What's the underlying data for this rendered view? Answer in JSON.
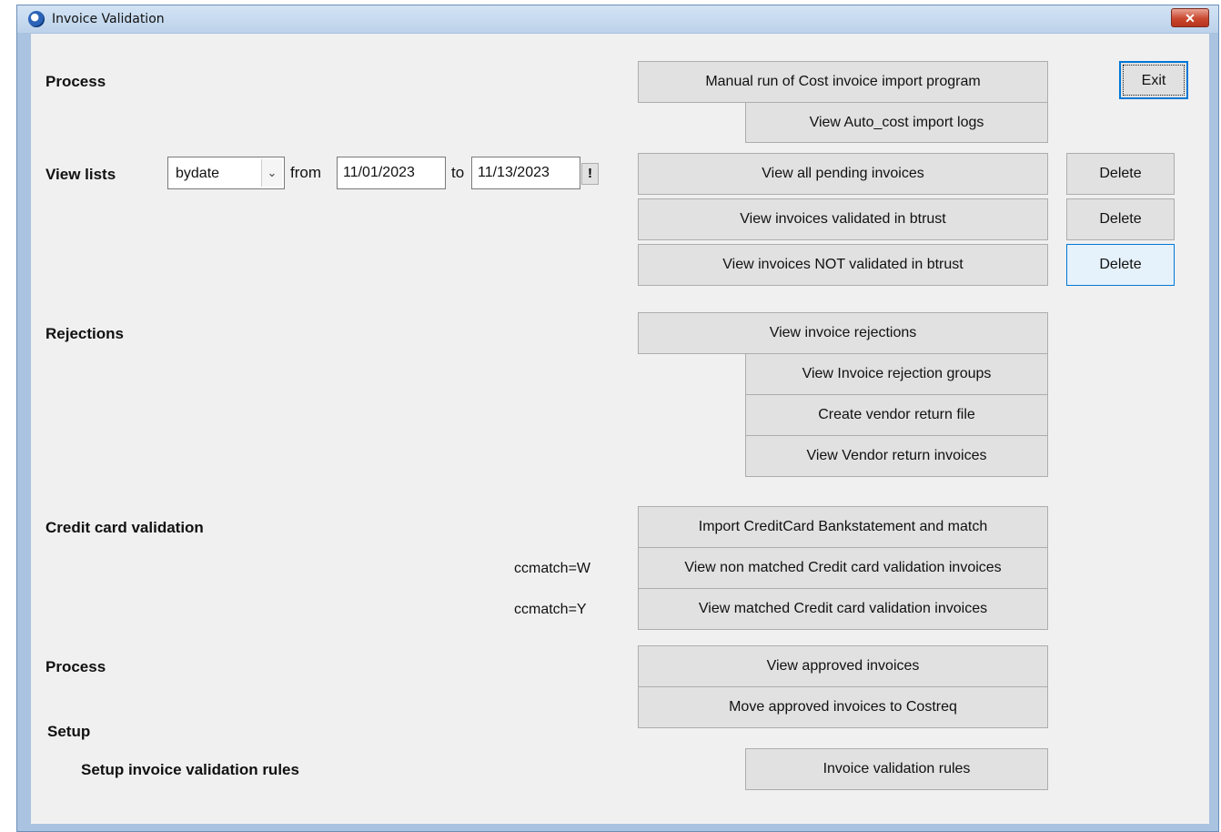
{
  "window": {
    "title": "Invoice Validation",
    "close_symbol": "✕"
  },
  "process": {
    "label": "Process",
    "manual_run_label": "Manual run of Cost invoice import program",
    "view_logs_label": "View Auto_cost import logs",
    "exit_label": "Exit"
  },
  "view_lists": {
    "label": "View lists",
    "mode_value": "bydate",
    "from_label": "from",
    "from_date": "11/01/2023",
    "to_label": "to",
    "to_date": "11/13/2023",
    "apply_label": "!",
    "pending_label": "View all pending invoices",
    "validated_label": "View invoices validated in btrust",
    "not_validated_label": "View invoices NOT validated in btrust",
    "delete_label": "Delete"
  },
  "rejections": {
    "label": "Rejections",
    "view_rejections_label": "View invoice rejections",
    "view_groups_label": "View Invoice rejection groups",
    "create_return_label": "Create vendor return file",
    "view_return_label": "View Vendor return invoices"
  },
  "credit_card": {
    "label": "Credit card validation",
    "import_label": "Import CreditCard Bankstatement and match",
    "ccmatch_w": "ccmatch=W",
    "non_matched_label": "View non matched Credit card validation invoices",
    "ccmatch_y": "ccmatch=Y",
    "matched_label": "View matched Credit card validation invoices"
  },
  "process2": {
    "label": "Process",
    "view_approved_label": "View approved invoices",
    "move_approved_label": "Move approved invoices to Costreq"
  },
  "setup": {
    "label": "Setup",
    "rules_heading": "Setup invoice validation rules",
    "rules_button_label": "Invoice validation rules"
  }
}
